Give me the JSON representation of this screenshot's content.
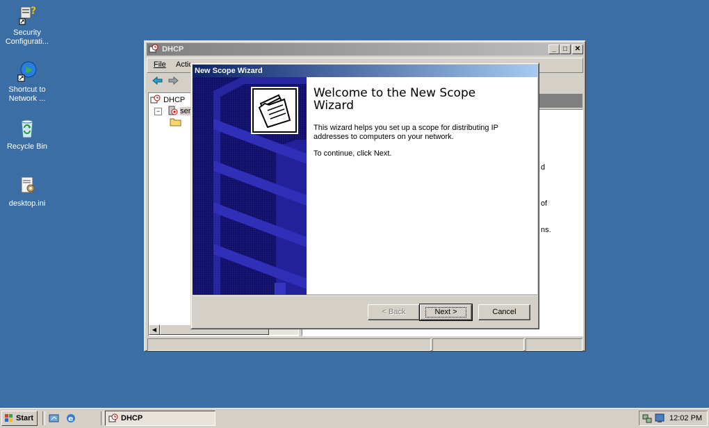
{
  "desktop": {
    "icons": [
      {
        "label": "Security Configurati..."
      },
      {
        "label": "Shortcut to Network ..."
      },
      {
        "label": "Recycle Bin"
      },
      {
        "label": "desktop.ini"
      }
    ]
  },
  "dhcp_window": {
    "title": "DHCP",
    "menu": {
      "file": "File",
      "action": "Actio"
    },
    "tree": {
      "root": "DHCP",
      "server": "serv"
    },
    "right_fragments": [
      "d",
      "of",
      "ns."
    ]
  },
  "wizard": {
    "title": "New Scope Wizard",
    "heading": "Welcome to the New Scope Wizard",
    "description": "This wizard helps you set up a scope for distributing IP addresses to computers on your network.",
    "instruction": "To continue, click Next.",
    "buttons": {
      "back": "< Back",
      "next": "Next >",
      "cancel": "Cancel"
    }
  },
  "taskbar": {
    "start": "Start",
    "task": "DHCP",
    "clock": "12:02 PM"
  },
  "colors": {
    "desktop": "#3a6ea5",
    "title_active": "#0a246a",
    "face": "#d4d0c8",
    "wizard_art": "#11116a"
  }
}
